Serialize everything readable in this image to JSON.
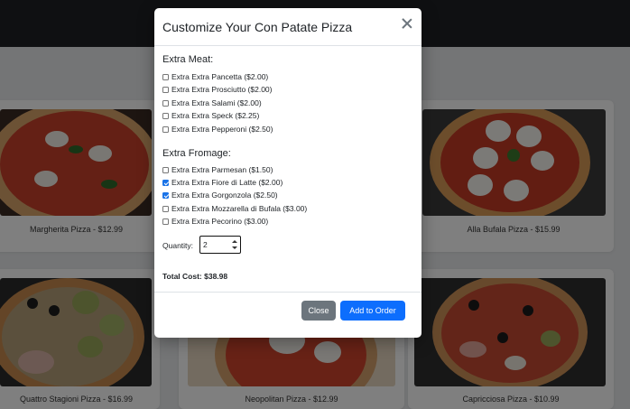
{
  "background_menu": {
    "cards": [
      {
        "name": "Margherita Pizza",
        "price": "$12.99",
        "caption": "Margherita Pizza - $12.99"
      },
      {
        "name": "Alla Bufala Pizza",
        "price": "$15.99",
        "caption": "Alla Bufala Pizza - $15.99"
      },
      {
        "name": "Quattro Stagioni Pizza",
        "price": "$16.99",
        "caption": "Quattro Stagioni Pizza - $16.99"
      },
      {
        "name": "Neopolitan Pizza",
        "price": "$12.99",
        "caption": "Neopolitan Pizza - $12.99"
      },
      {
        "name": "Capricciosa Pizza",
        "price": "$10.99",
        "caption": "Capricciosa Pizza - $10.99"
      }
    ]
  },
  "modal": {
    "title": "Customize Your Con Patate Pizza",
    "sections": [
      {
        "title": "Extra Meat:",
        "options": [
          {
            "label": "Extra Extra Pancetta ($2.00)",
            "checked": false
          },
          {
            "label": "Extra Extra Prosciutto ($2.00)",
            "checked": false
          },
          {
            "label": "Extra Extra Salami ($2.00)",
            "checked": false
          },
          {
            "label": "Extra Extra Speck ($2.25)",
            "checked": false
          },
          {
            "label": "Extra Extra Pepperoni ($2.50)",
            "checked": false
          }
        ]
      },
      {
        "title": "Extra Fromage:",
        "options": [
          {
            "label": "Extra Extra Parmesan ($1.50)",
            "checked": false
          },
          {
            "label": "Extra Extra Fiore di Latte ($2.00)",
            "checked": true
          },
          {
            "label": "Extra Extra Gorgonzola ($2.50)",
            "checked": true
          },
          {
            "label": "Extra Extra Mozzarella di Bufala ($3.00)",
            "checked": false
          },
          {
            "label": "Extra Extra Pecorino ($3.00)",
            "checked": false
          }
        ]
      }
    ],
    "quantity_label": "Quantity:",
    "quantity_value": "2",
    "total_cost": "Total Cost: $38.98",
    "close_label": "Close",
    "add_label": "Add to Order"
  },
  "colors": {
    "navbar": "#1e2125",
    "primary": "#0d6efd",
    "secondary": "#6c757d"
  }
}
